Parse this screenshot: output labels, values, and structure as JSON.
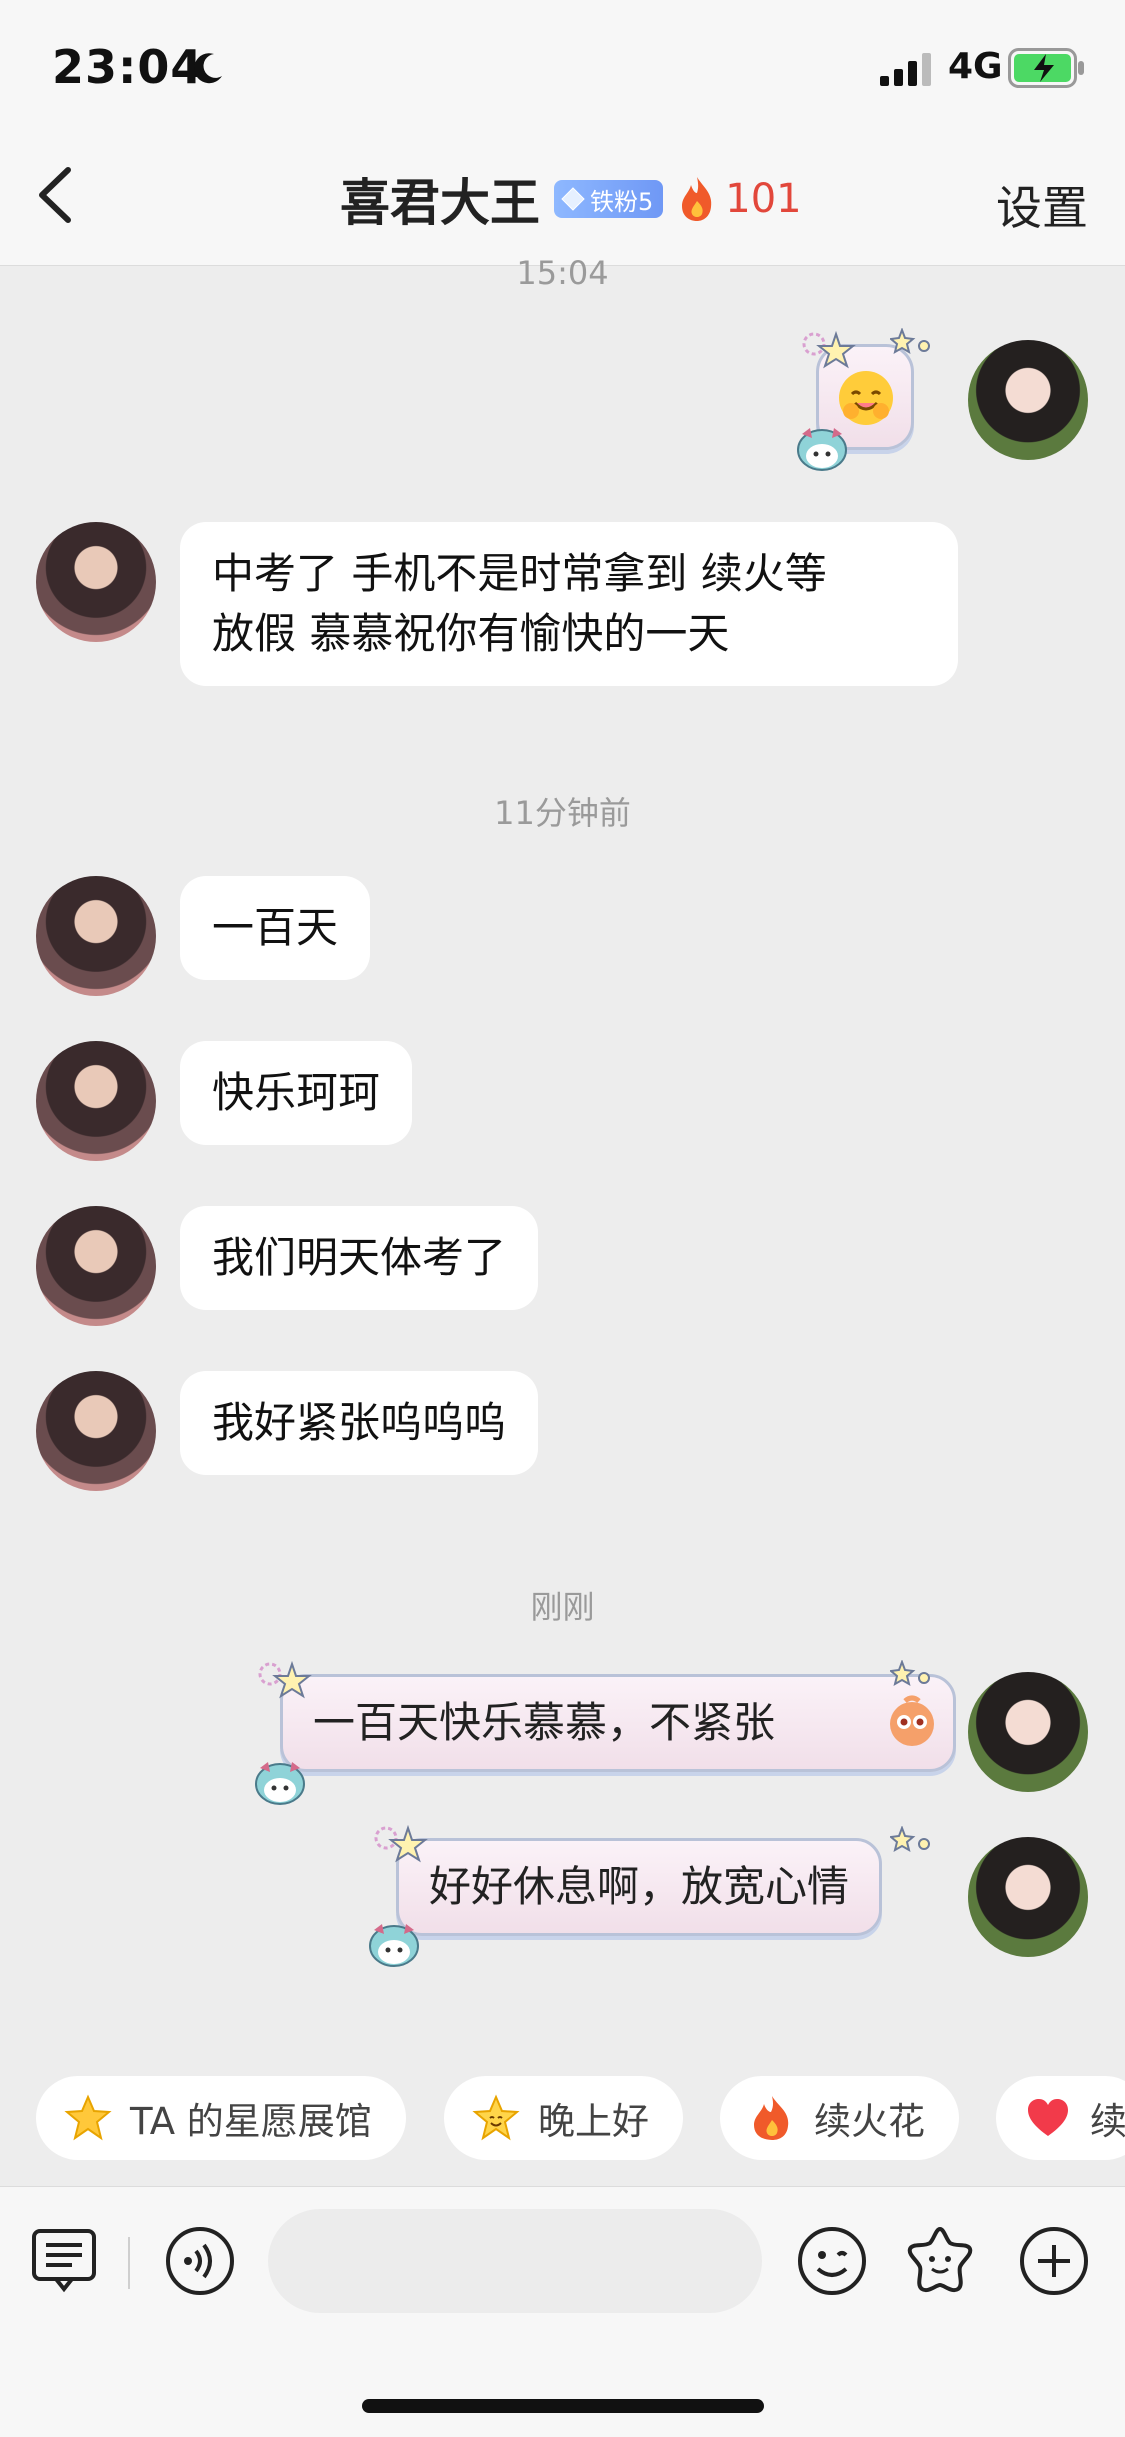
{
  "status_bar": {
    "time": "23:04",
    "network": "4G"
  },
  "header": {
    "title": "喜君大王",
    "fan_badge": "铁粉5",
    "fire_count": "101",
    "settings_label": "设置"
  },
  "messages": {
    "ts1": "15:04",
    "m1": "中考了 手机不是时常拿到 续火等",
    "m1b": "放假 慕慕祝你有愉快的一天",
    "ts2": "11分钟前",
    "m2": "一百天",
    "m3": "快乐珂珂",
    "m4": "我们明天体考了",
    "m5": "我好紧张呜呜呜",
    "ts3": "刚刚",
    "r1": "一百天快乐慕慕，不紧张",
    "r2": "好好休息啊，放宽心情"
  },
  "quick_replies": [
    {
      "label": "TA 的星愿展馆",
      "icon": "star-icon"
    },
    {
      "label": "晚上好",
      "icon": "smiling-star-icon"
    },
    {
      "label": "续火花",
      "icon": "fire-icon"
    },
    {
      "label": "续",
      "icon": "heart-icon"
    }
  ],
  "input": {
    "placeholder": ""
  },
  "colors": {
    "fire": "#e2473b",
    "badge": "#7aa3f7",
    "background": "#ededed"
  }
}
